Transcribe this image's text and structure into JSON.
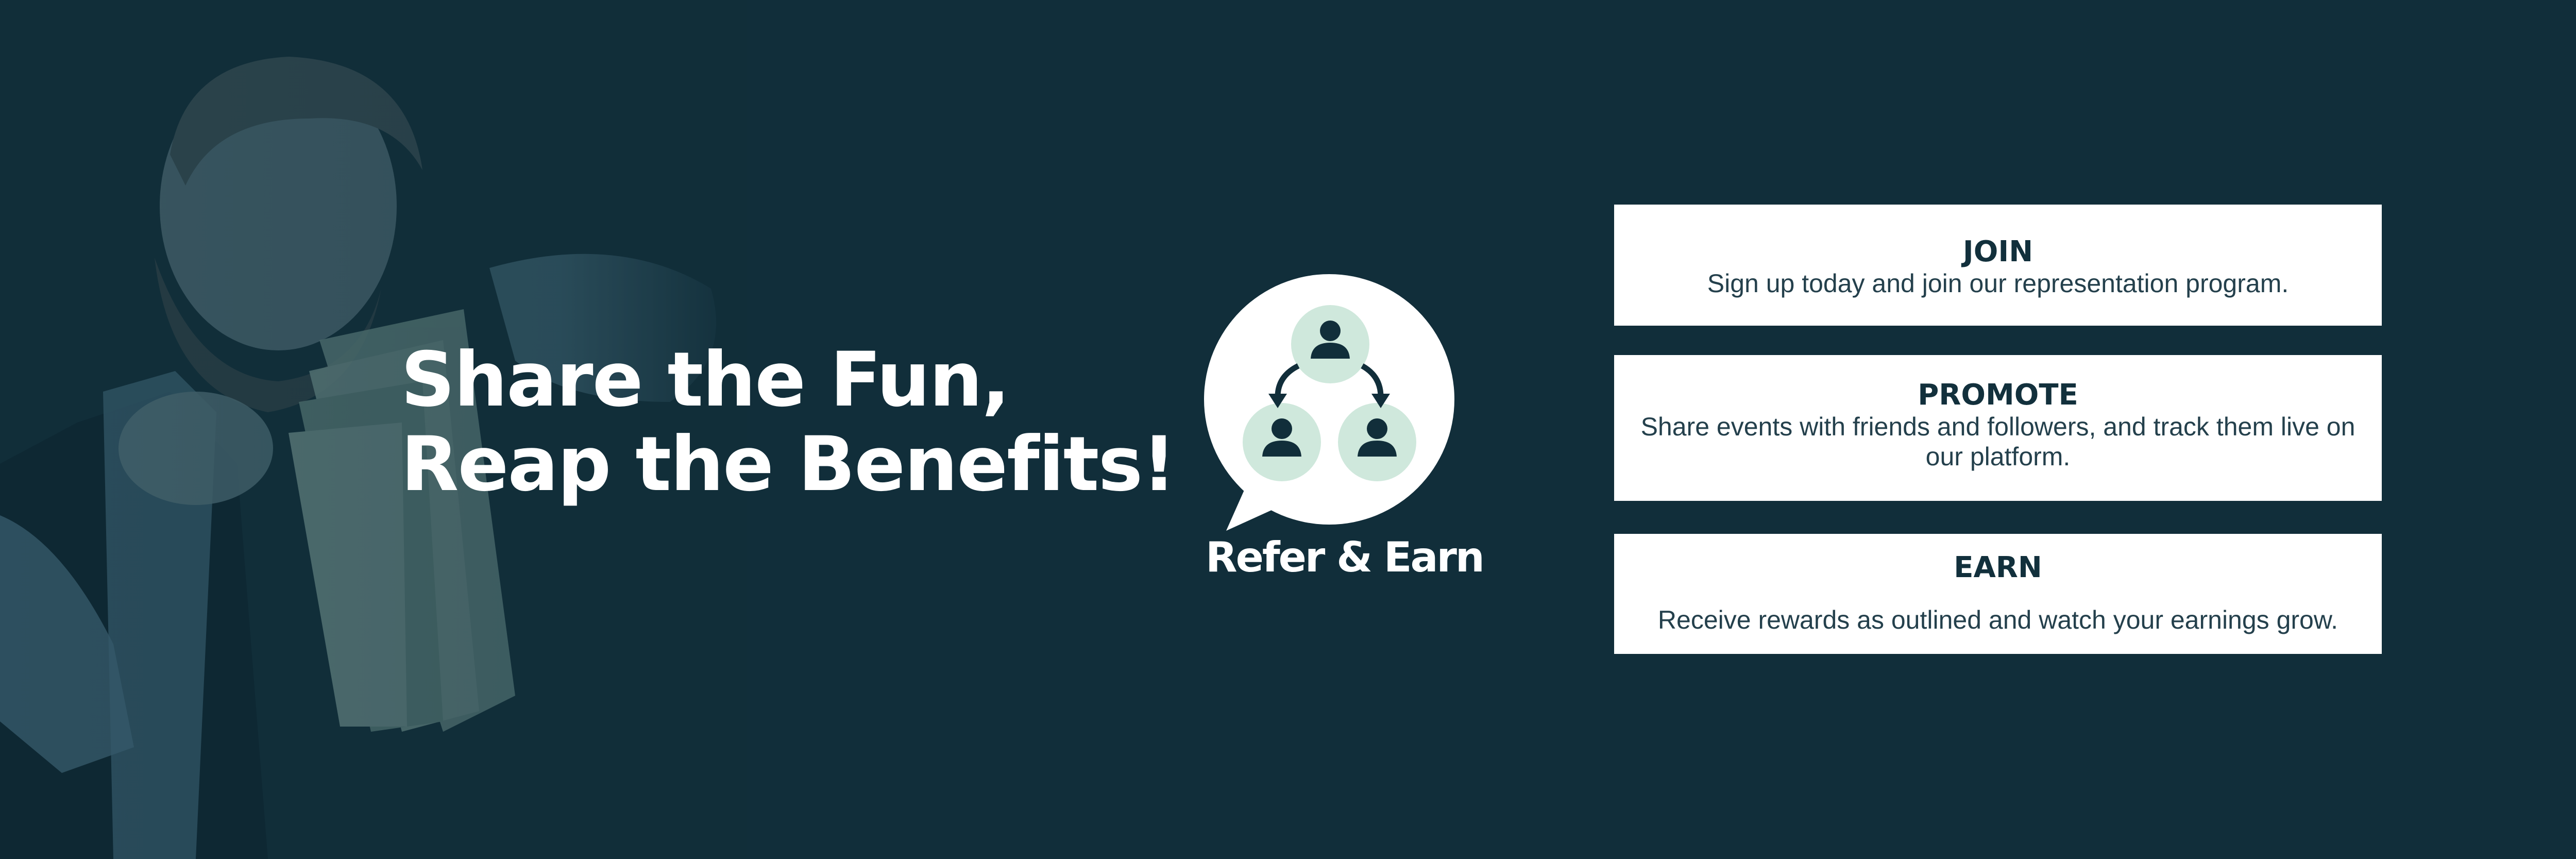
{
  "banner": {
    "background_color": "#112e3a",
    "headline": {
      "line1": "Share the Fun,",
      "line2": "Reap the Benefits!"
    },
    "logo": {
      "icon": "referral-network-icon",
      "label": "Refer & Earn",
      "accent_color": "#cfe8dc"
    },
    "photo": {
      "icon": "man-holding-cash-photo"
    },
    "steps": [
      {
        "title": "JOIN",
        "description": "Sign up today and join our representation program."
      },
      {
        "title": "PROMOTE",
        "description": "Share events with friends and followers, and track them live on our platform."
      },
      {
        "title": "EARN",
        "description": "Receive rewards as outlined and watch your earnings grow."
      }
    ]
  }
}
